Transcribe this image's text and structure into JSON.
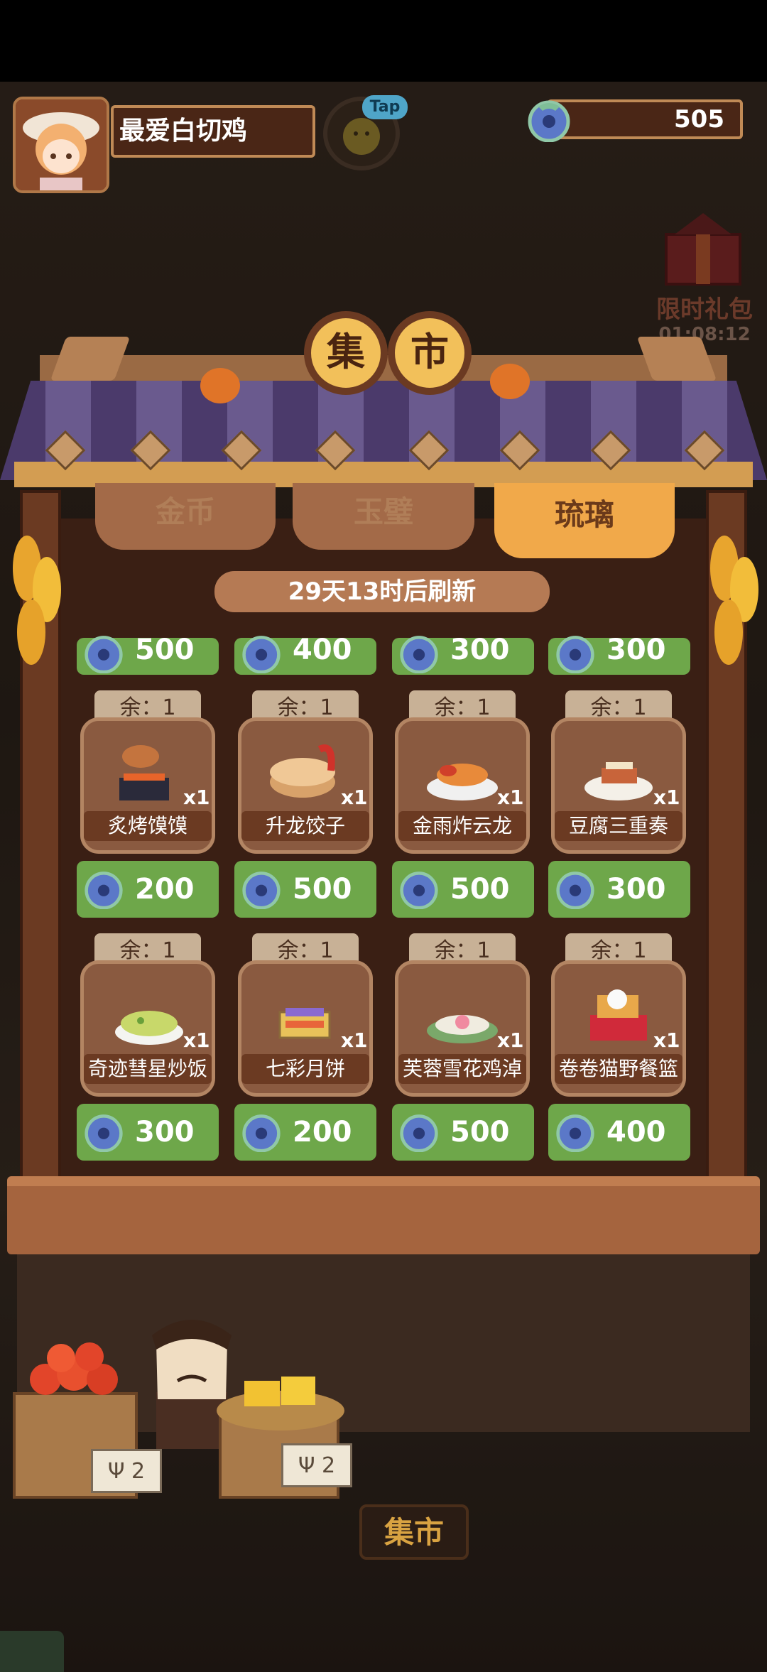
{
  "player": {
    "name": "最爱白切鸡",
    "gems": "505"
  },
  "tap_badge": "Tap",
  "gift": {
    "label": "限时礼包",
    "timer": "01:08:12"
  },
  "title": {
    "char1": "集",
    "char2": "市"
  },
  "tabs": {
    "gold": "金币",
    "jade": "玉璧",
    "glaze": "琉璃",
    "active": "琉璃"
  },
  "refresh_text": "29天13时后刷新",
  "top_partial_prices": [
    "500",
    "400",
    "300",
    "300"
  ],
  "rows": [
    {
      "items": [
        {
          "remaining": "余：1",
          "name": "炙烤馍馍",
          "qty": "x1",
          "price": "200"
        },
        {
          "remaining": "余：1",
          "name": "升龙饺子",
          "qty": "x1",
          "price": "500"
        },
        {
          "remaining": "余：1",
          "name": "金雨炸云龙",
          "qty": "x1",
          "price": "500"
        },
        {
          "remaining": "余：1",
          "name": "豆腐三重奏",
          "qty": "x1",
          "price": "300"
        }
      ]
    },
    {
      "items": [
        {
          "remaining": "余：1",
          "name": "奇迹彗星炒饭",
          "qty": "x1",
          "price": "300"
        },
        {
          "remaining": "余：1",
          "name": "七彩月饼",
          "qty": "x1",
          "price": "200"
        },
        {
          "remaining": "余：1",
          "name": "芙蓉雪花鸡淖",
          "qty": "x1",
          "price": "500"
        },
        {
          "remaining": "余：1",
          "name": "卷卷猫野餐篮",
          "qty": "x1",
          "price": "400"
        }
      ]
    }
  ],
  "crates": {
    "left_tag": "Ψ 2",
    "right_tag": "Ψ 2"
  },
  "market_button": "集市",
  "colors": {
    "gem": "#6f8ee8",
    "price_bg": "#6ea74a",
    "active_tab": "#f1a94a"
  }
}
